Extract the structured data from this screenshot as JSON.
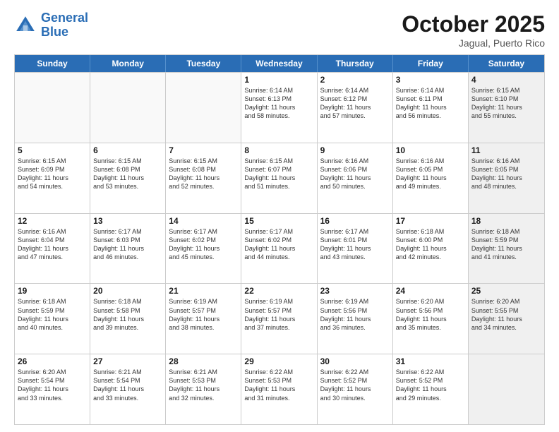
{
  "header": {
    "logo_line1": "General",
    "logo_line2": "Blue",
    "month": "October 2025",
    "location": "Jagual, Puerto Rico"
  },
  "days_of_week": [
    "Sunday",
    "Monday",
    "Tuesday",
    "Wednesday",
    "Thursday",
    "Friday",
    "Saturday"
  ],
  "rows": [
    [
      {
        "day": "",
        "text": "",
        "empty": true
      },
      {
        "day": "",
        "text": "",
        "empty": true
      },
      {
        "day": "",
        "text": "",
        "empty": true
      },
      {
        "day": "1",
        "text": "Sunrise: 6:14 AM\nSunset: 6:13 PM\nDaylight: 11 hours\nand 58 minutes."
      },
      {
        "day": "2",
        "text": "Sunrise: 6:14 AM\nSunset: 6:12 PM\nDaylight: 11 hours\nand 57 minutes."
      },
      {
        "day": "3",
        "text": "Sunrise: 6:14 AM\nSunset: 6:11 PM\nDaylight: 11 hours\nand 56 minutes."
      },
      {
        "day": "4",
        "text": "Sunrise: 6:15 AM\nSunset: 6:10 PM\nDaylight: 11 hours\nand 55 minutes.",
        "shaded": true
      }
    ],
    [
      {
        "day": "5",
        "text": "Sunrise: 6:15 AM\nSunset: 6:09 PM\nDaylight: 11 hours\nand 54 minutes."
      },
      {
        "day": "6",
        "text": "Sunrise: 6:15 AM\nSunset: 6:08 PM\nDaylight: 11 hours\nand 53 minutes."
      },
      {
        "day": "7",
        "text": "Sunrise: 6:15 AM\nSunset: 6:08 PM\nDaylight: 11 hours\nand 52 minutes."
      },
      {
        "day": "8",
        "text": "Sunrise: 6:15 AM\nSunset: 6:07 PM\nDaylight: 11 hours\nand 51 minutes."
      },
      {
        "day": "9",
        "text": "Sunrise: 6:16 AM\nSunset: 6:06 PM\nDaylight: 11 hours\nand 50 minutes."
      },
      {
        "day": "10",
        "text": "Sunrise: 6:16 AM\nSunset: 6:05 PM\nDaylight: 11 hours\nand 49 minutes."
      },
      {
        "day": "11",
        "text": "Sunrise: 6:16 AM\nSunset: 6:05 PM\nDaylight: 11 hours\nand 48 minutes.",
        "shaded": true
      }
    ],
    [
      {
        "day": "12",
        "text": "Sunrise: 6:16 AM\nSunset: 6:04 PM\nDaylight: 11 hours\nand 47 minutes."
      },
      {
        "day": "13",
        "text": "Sunrise: 6:17 AM\nSunset: 6:03 PM\nDaylight: 11 hours\nand 46 minutes."
      },
      {
        "day": "14",
        "text": "Sunrise: 6:17 AM\nSunset: 6:02 PM\nDaylight: 11 hours\nand 45 minutes."
      },
      {
        "day": "15",
        "text": "Sunrise: 6:17 AM\nSunset: 6:02 PM\nDaylight: 11 hours\nand 44 minutes."
      },
      {
        "day": "16",
        "text": "Sunrise: 6:17 AM\nSunset: 6:01 PM\nDaylight: 11 hours\nand 43 minutes."
      },
      {
        "day": "17",
        "text": "Sunrise: 6:18 AM\nSunset: 6:00 PM\nDaylight: 11 hours\nand 42 minutes."
      },
      {
        "day": "18",
        "text": "Sunrise: 6:18 AM\nSunset: 5:59 PM\nDaylight: 11 hours\nand 41 minutes.",
        "shaded": true
      }
    ],
    [
      {
        "day": "19",
        "text": "Sunrise: 6:18 AM\nSunset: 5:59 PM\nDaylight: 11 hours\nand 40 minutes."
      },
      {
        "day": "20",
        "text": "Sunrise: 6:18 AM\nSunset: 5:58 PM\nDaylight: 11 hours\nand 39 minutes."
      },
      {
        "day": "21",
        "text": "Sunrise: 6:19 AM\nSunset: 5:57 PM\nDaylight: 11 hours\nand 38 minutes."
      },
      {
        "day": "22",
        "text": "Sunrise: 6:19 AM\nSunset: 5:57 PM\nDaylight: 11 hours\nand 37 minutes."
      },
      {
        "day": "23",
        "text": "Sunrise: 6:19 AM\nSunset: 5:56 PM\nDaylight: 11 hours\nand 36 minutes."
      },
      {
        "day": "24",
        "text": "Sunrise: 6:20 AM\nSunset: 5:56 PM\nDaylight: 11 hours\nand 35 minutes."
      },
      {
        "day": "25",
        "text": "Sunrise: 6:20 AM\nSunset: 5:55 PM\nDaylight: 11 hours\nand 34 minutes.",
        "shaded": true
      }
    ],
    [
      {
        "day": "26",
        "text": "Sunrise: 6:20 AM\nSunset: 5:54 PM\nDaylight: 11 hours\nand 33 minutes."
      },
      {
        "day": "27",
        "text": "Sunrise: 6:21 AM\nSunset: 5:54 PM\nDaylight: 11 hours\nand 33 minutes."
      },
      {
        "day": "28",
        "text": "Sunrise: 6:21 AM\nSunset: 5:53 PM\nDaylight: 11 hours\nand 32 minutes."
      },
      {
        "day": "29",
        "text": "Sunrise: 6:22 AM\nSunset: 5:53 PM\nDaylight: 11 hours\nand 31 minutes."
      },
      {
        "day": "30",
        "text": "Sunrise: 6:22 AM\nSunset: 5:52 PM\nDaylight: 11 hours\nand 30 minutes."
      },
      {
        "day": "31",
        "text": "Sunrise: 6:22 AM\nSunset: 5:52 PM\nDaylight: 11 hours\nand 29 minutes."
      },
      {
        "day": "",
        "text": "",
        "empty": true,
        "shaded": true
      }
    ]
  ]
}
